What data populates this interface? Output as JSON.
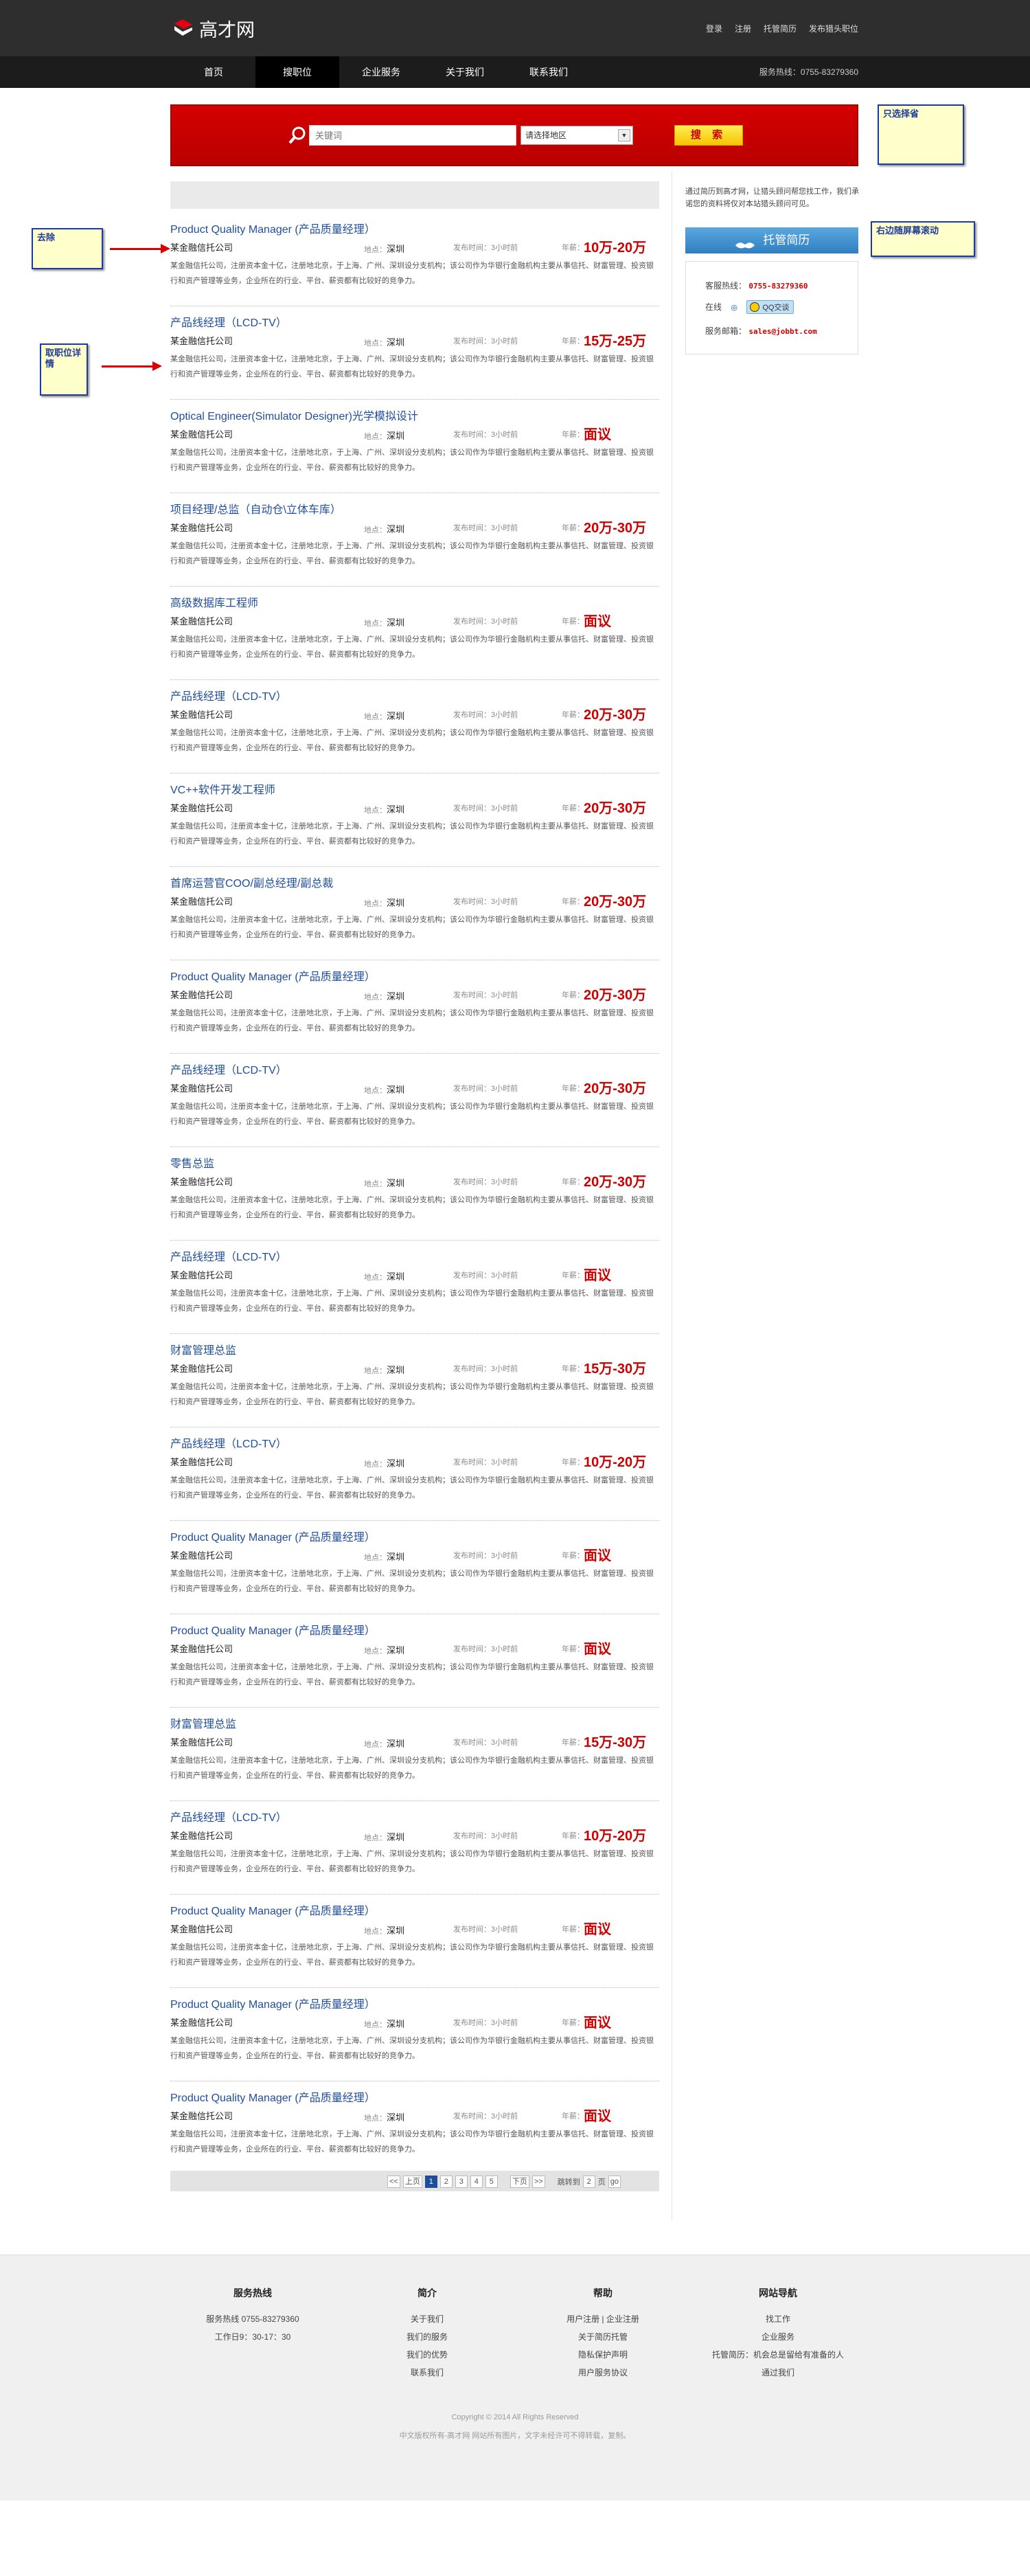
{
  "header": {
    "logo_text": "高才网",
    "links": [
      "登录",
      "注册",
      "托管简历",
      "发布猎头职位"
    ]
  },
  "nav": {
    "items": [
      "首页",
      "搜职位",
      "企业服务",
      "关于我们",
      "联系我们"
    ],
    "active_index": 1,
    "hotline": "服务热线：0755-83279360"
  },
  "search": {
    "placeholder": "关键词",
    "city_value": "请选择地区",
    "button_label": "搜 索"
  },
  "notes": {
    "only_select_city": "只选择省",
    "remove": "去除",
    "job_detail": "取职位详情",
    "right_scroll": "右边随屏幕滚动"
  },
  "sidebar": {
    "intro": "通过简历到高才网，让猎头顾问帮您找工作，我们承诺您的资料将仅对本站猎头顾问可见。",
    "entrust_button": "托管简历",
    "hotline_label": "客服热线：",
    "hotline_value": "0755-83279360",
    "online_label": "在线",
    "qq_label": "QQ交谈",
    "email_label": "服务邮箱：",
    "email_value": "sales@jobbt.com"
  },
  "jobs": [
    {
      "title": "Product Quality Manager (产品质量经理）",
      "company": "某金融信托公司",
      "salary": "10万-20万"
    },
    {
      "title": "产品线经理（LCD-TV）",
      "company": "某金融信托公司",
      "salary": "15万-25万"
    },
    {
      "title": "Optical Engineer(Simulator Designer)光学模拟设计",
      "company": "某金融信托公司",
      "salary": "面议"
    },
    {
      "title": "项目经理/总监（自动仓\\立体车库）",
      "company": "某金融信托公司",
      "salary": "20万-30万"
    },
    {
      "title": "高级数据库工程师",
      "company": "某金融信托公司",
      "salary": "面议"
    },
    {
      "title": "产品线经理（LCD-TV）",
      "company": "某金融信托公司",
      "salary": "20万-30万"
    },
    {
      "title": "VC++软件开发工程师",
      "company": "某金融信托公司",
      "salary": "20万-30万"
    },
    {
      "title": "首席运营官COO/副总经理/副总裁",
      "company": "某金融信托公司",
      "salary": "20万-30万"
    },
    {
      "title": "Product Quality Manager (产品质量经理）",
      "company": "某金融信托公司",
      "salary": "20万-30万"
    },
    {
      "title": "产品线经理（LCD-TV）",
      "company": "某金融信托公司",
      "salary": "20万-30万"
    },
    {
      "title": "零售总监",
      "company": "某金融信托公司",
      "salary": "20万-30万"
    },
    {
      "title": "产品线经理（LCD-TV）",
      "company": "某金融信托公司",
      "salary": "面议"
    },
    {
      "title": "财富管理总监",
      "company": "某金融信托公司",
      "salary": "15万-30万"
    },
    {
      "title": "产品线经理（LCD-TV）",
      "company": "某金融信托公司",
      "salary": "10万-20万"
    },
    {
      "title": "Product Quality Manager (产品质量经理）",
      "company": "某金融信托公司",
      "salary": "面议"
    },
    {
      "title": "Product Quality Manager (产品质量经理）",
      "company": "某金融信托公司",
      "salary": "面议"
    },
    {
      "title": "财富管理总监",
      "company": "某金融信托公司",
      "salary": "15万-30万"
    },
    {
      "title": "产品线经理（LCD-TV）",
      "company": "某金融信托公司",
      "salary": "10万-20万"
    },
    {
      "title": "Product Quality Manager (产品质量经理）",
      "company": "某金融信托公司",
      "salary": "面议"
    },
    {
      "title": "Product Quality Manager (产品质量经理）",
      "company": "某金融信托公司",
      "salary": "面议"
    },
    {
      "title": "Product Quality Manager (产品质量经理）",
      "company": "某金融信托公司",
      "salary": "面议"
    }
  ],
  "job_common": {
    "location_label": "地点：",
    "location": "深圳",
    "date": "发布时间：3小时前",
    "salary_label": "年薪：",
    "description": "某金融信托公司，注册资本金十亿，注册地北京，于上海、广州、深圳设分支机构；该公司作为华银行金融机构主要从事信托、财富管理、投资银行和资产管理等业务，企业所在的行业、平台、薪资都有比较好的竞争力。"
  },
  "pager": {
    "first": "<<",
    "prev": "上页",
    "pages": [
      "1",
      "2",
      "3",
      "4",
      "5"
    ],
    "current_index": 0,
    "next": "下页",
    "last": ">>",
    "jump_label": "跳转到",
    "jump_value": "2",
    "page_unit": "页",
    "go": "go"
  },
  "footer": {
    "columns": [
      {
        "title": "服务热线",
        "items": [
          "服务热线 0755-83279360",
          "工作日9：30-17：30"
        ]
      },
      {
        "title": "简介",
        "items": [
          "关于我们",
          "我们的服务",
          "我们的优势",
          "联系我们"
        ]
      },
      {
        "title": "帮助",
        "items": [
          "用户注册 | 企业注册",
          "关于简历托管",
          "隐私保护声明",
          "用户服务协议"
        ]
      },
      {
        "title": "网站导航",
        "items": [
          "找工作",
          "企业服务",
          "托管简历：机会总是留给有准备的人",
          "通过我们"
        ]
      }
    ],
    "copyright": "Copyright © 2014 All Rights Reserved",
    "icp": "中文版权所有-高才网 网站所有图片，文字未经许可不得转载，复制。"
  }
}
